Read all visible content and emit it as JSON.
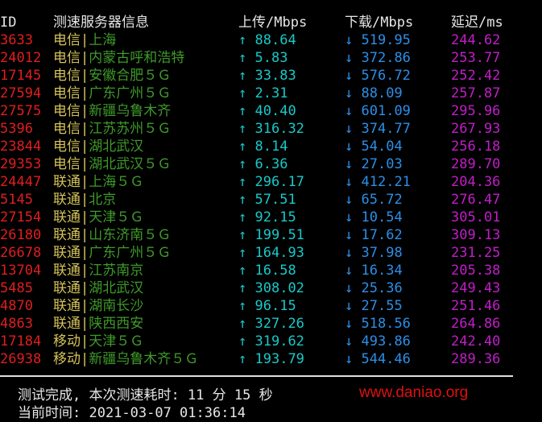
{
  "colors": {
    "background": "#000000",
    "id": "#e01e1e",
    "isp": "#d4c25a",
    "location": "#3f9a2a",
    "upload": "#19c8c8",
    "download": "#2b8fe8",
    "latency": "#c21ec8",
    "text": "#e6e6e6"
  },
  "header": {
    "id": "ID",
    "info": "测速服务器信息",
    "upload": "上传/Mbps",
    "download": "下载/Mbps",
    "latency": "延迟/ms"
  },
  "up_arrow": "↑",
  "down_arrow": "↓",
  "separator": "|",
  "rows": [
    {
      "id": "3633",
      "isp": "电信",
      "location": "上海",
      "upload": "88.64",
      "download": "519.95",
      "latency": "244.62"
    },
    {
      "id": "24012",
      "isp": "电信",
      "location": "内蒙古呼和浩特",
      "upload": "5.83",
      "download": "372.86",
      "latency": "253.77"
    },
    {
      "id": "17145",
      "isp": "电信",
      "location": "安徽合肥５Ｇ",
      "upload": "33.83",
      "download": "576.72",
      "latency": "252.42"
    },
    {
      "id": "27594",
      "isp": "电信",
      "location": "广东广州５Ｇ",
      "upload": "2.31",
      "download": "88.09",
      "latency": "257.87"
    },
    {
      "id": "27575",
      "isp": "电信",
      "location": "新疆乌鲁木齐",
      "upload": "40.40",
      "download": "601.09",
      "latency": "295.96"
    },
    {
      "id": "5396",
      "isp": "电信",
      "location": "江苏苏州５Ｇ",
      "upload": "316.32",
      "download": "374.77",
      "latency": "267.93"
    },
    {
      "id": "23844",
      "isp": "电信",
      "location": "湖北武汉",
      "upload": "8.14",
      "download": "54.04",
      "latency": "256.18"
    },
    {
      "id": "29353",
      "isp": "电信",
      "location": "湖北武汉５Ｇ",
      "upload": "6.36",
      "download": "27.03",
      "latency": "289.70"
    },
    {
      "id": "24447",
      "isp": "联通",
      "location": "上海５Ｇ",
      "upload": "296.17",
      "download": "412.21",
      "latency": "204.36"
    },
    {
      "id": "5145",
      "isp": "联通",
      "location": "北京",
      "upload": "57.51",
      "download": "65.72",
      "latency": "276.47"
    },
    {
      "id": "27154",
      "isp": "联通",
      "location": "天津５Ｇ",
      "upload": "92.15",
      "download": "10.54",
      "latency": "305.01"
    },
    {
      "id": "26180",
      "isp": "联通",
      "location": "山东济南５Ｇ",
      "upload": "199.51",
      "download": "17.62",
      "latency": "309.13"
    },
    {
      "id": "26678",
      "isp": "联通",
      "location": "广东广州５Ｇ",
      "upload": "164.93",
      "download": "37.98",
      "latency": "231.25"
    },
    {
      "id": "13704",
      "isp": "联通",
      "location": "江苏南京",
      "upload": "16.58",
      "download": "16.34",
      "latency": "205.38"
    },
    {
      "id": "5485",
      "isp": "联通",
      "location": "湖北武汉",
      "upload": "308.02",
      "download": "25.36",
      "latency": "249.43"
    },
    {
      "id": "4870",
      "isp": "联通",
      "location": "湖南长沙",
      "upload": "96.15",
      "download": "27.55",
      "latency": "251.46"
    },
    {
      "id": "4863",
      "isp": "联通",
      "location": "陕西西安",
      "upload": "327.26",
      "download": "518.56",
      "latency": "264.86"
    },
    {
      "id": "17184",
      "isp": "移动",
      "location": "天津５Ｇ",
      "upload": "319.62",
      "download": "493.86",
      "latency": "242.40"
    },
    {
      "id": "26938",
      "isp": "移动",
      "location": "新疆乌鲁木齐５Ｇ",
      "upload": "193.79",
      "download": "544.46",
      "latency": "289.36"
    }
  ],
  "footer": {
    "completion": "测试完成, 本次测速耗时: 11 分 15 秒",
    "current_time": "当前时间: 2021-03-07 01:36:14"
  },
  "watermark": "www.daniao.org"
}
